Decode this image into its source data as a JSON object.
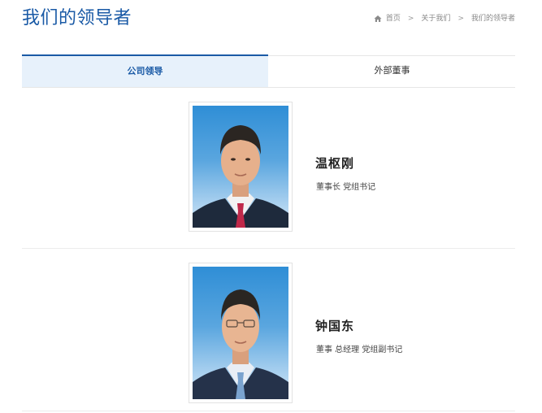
{
  "header": {
    "title": "我们的领导者"
  },
  "breadcrumb": {
    "home_icon": "home-icon",
    "items": [
      "首页",
      "关于我们",
      "我们的领导者"
    ],
    "separator": ">"
  },
  "tabs": [
    {
      "label": "公司领导",
      "active": true
    },
    {
      "label": "外部董事",
      "active": false
    }
  ],
  "leaders": [
    {
      "name": "温枢刚",
      "title": "董事长 党组书记"
    },
    {
      "name": "钟国东",
      "title": "董事 总经理 党组副书记"
    }
  ],
  "colors": {
    "accent": "#1a5aa6",
    "tab_active_bg": "#e7f1fb",
    "photo_background": "#3b94d8"
  }
}
